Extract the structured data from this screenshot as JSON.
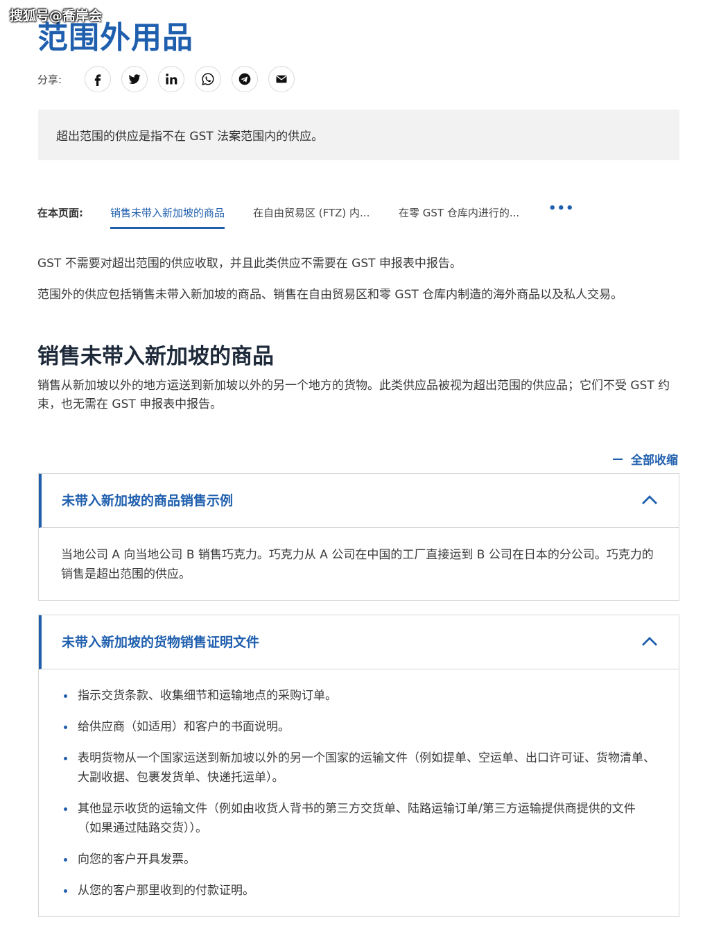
{
  "watermark": "搜狐号@喬岸会",
  "page_title": "范围外用品",
  "share": {
    "label": "分享:",
    "buttons": [
      "facebook-icon",
      "twitter-icon",
      "linkedin-icon",
      "whatsapp-icon",
      "telegram-icon",
      "email-icon"
    ]
  },
  "summary": "超出范围的供应是指不在 GST 法案范围内的供应。",
  "on_this_page": {
    "label": "在本页面:",
    "links": [
      "销售未带入新加坡的商品",
      "在自由贸易区 (FTZ) 内...",
      "在零 GST 仓库内进行的..."
    ],
    "more": "•••"
  },
  "intro": [
    "GST 不需要对超出范围的供应收取，并且此类供应不需要在 GST 申报表中报告。",
    "范围外的供应包括销售未带入新加坡的商品、销售在自由贸易区和零 GST 仓库内制造的海外商品以及私人交易。"
  ],
  "section": {
    "heading": "销售未带入新加坡的商品",
    "body": "销售从新加坡以外的地方运送到新加坡以外的另一个地方的货物。此类供应品被视为超出范围的供应品；它们不受 GST 约束，也无需在 GST 申报表中报告。"
  },
  "collapse_all": "全部收缩",
  "accordions": [
    {
      "title": "未带入新加坡的商品销售示例",
      "body": "当地公司 A 向当地公司 B 销售巧克力。巧克力从 A 公司在中国的工厂直接运到 B 公司在日本的分公司。巧克力的销售是超出范围的供应。"
    },
    {
      "title": "未带入新加坡的货物销售证明文件",
      "items": [
        "指示交货条款、收集细节和运输地点的采购订单。",
        "给供应商（如适用）和客户的书面说明。",
        "表明货物从一个国家运送到新加坡以外的另一个国家的运输文件（例如提单、空运单、出口许可证、货物清单、大副收据、包裹发货单、快递托运单）。",
        "其他显示收货的运输文件（例如由收货人背书的第三方交货单、陆路运输订单/第三方运输提供商提供的文件（如果通过陆路交货））。",
        "向您的客户开具发票。",
        "从您的客户那里收到的付款证明。"
      ]
    }
  ],
  "colors": {
    "accent": "#1f5fae",
    "summary_bg": "#f2f2f2",
    "heading": "#1e2a3a"
  }
}
